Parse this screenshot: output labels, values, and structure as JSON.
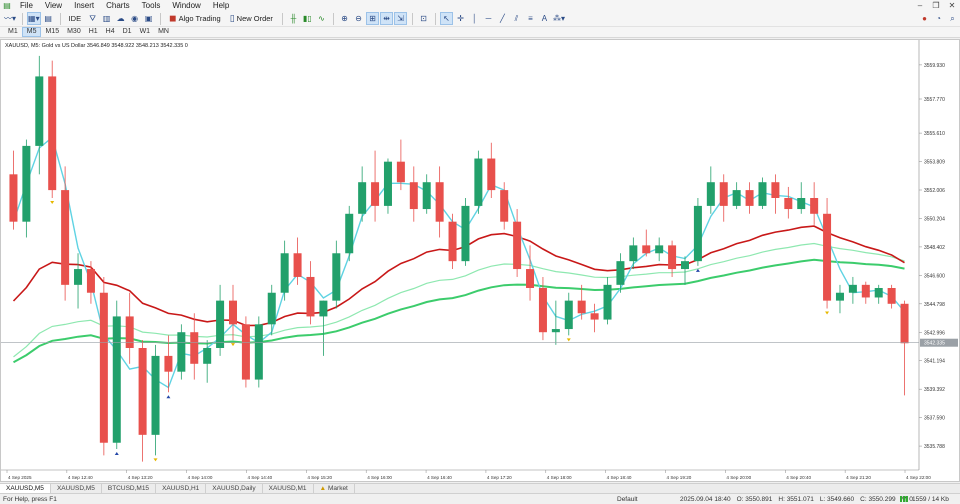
{
  "menu": [
    "File",
    "View",
    "Insert",
    "Charts",
    "Tools",
    "Window",
    "Help"
  ],
  "toolbar": {
    "ide_label": "IDE",
    "algo_label": "Algo Trading",
    "new_order_label": "New Order"
  },
  "timeframes": [
    "M1",
    "M5",
    "M15",
    "M30",
    "H1",
    "H4",
    "D1",
    "W1",
    "MN"
  ],
  "active_timeframe": "M5",
  "chart_header": "XAUUSD, M5:  Gold vs US Dollar  3546.849 3548.922 3548.213 3542.335  0",
  "chart_data": {
    "type": "candlestick",
    "symbol": "XAUUSD",
    "timeframe": "M5",
    "ylim": [
      3534.4,
      3561.0
    ],
    "price_ticks": [
      "3559.930",
      "3557.770",
      "3555.610",
      "3553.809",
      "3552.006",
      "3550.204",
      "3548.402",
      "3546.600",
      "3544.798",
      "3542.996",
      "3541.194",
      "3539.392",
      "3537.590",
      "3535.788"
    ],
    "current_price": "3542.335",
    "time_ticks": [
      "4 Sep 2025",
      "4 Sep 12:40",
      "4 Sep 13:20",
      "4 Sep 14:00",
      "4 Sep 14:40",
      "4 Sep 15:20",
      "4 Sep 16:00",
      "4 Sep 16:40",
      "4 Sep 17:20",
      "4 Sep 18:00",
      "4 Sep 18:40",
      "4 Sep 19:20",
      "4 Sep 20:00",
      "4 Sep 20:40",
      "4 Sep 21:20",
      "4 Sep 22:00"
    ],
    "colors": {
      "bull": "#22a06b",
      "bear": "#e8504c",
      "ma_fast": "#5fd3e3",
      "ma_slow": "#c81818",
      "ma_green1": "#3ccc6c",
      "ma_green2": "#8ee8b0"
    },
    "candles": [
      [
        3553.0,
        3554.5,
        3549.5,
        3550.0
      ],
      [
        3550.0,
        3555.2,
        3549.0,
        3554.8
      ],
      [
        3554.8,
        3560.5,
        3553.0,
        3559.2
      ],
      [
        3559.2,
        3560.2,
        3551.5,
        3552.0
      ],
      [
        3552.0,
        3553.5,
        3545.0,
        3546.0
      ],
      [
        3546.0,
        3548.0,
        3544.5,
        3547.0
      ],
      [
        3547.0,
        3547.5,
        3544.8,
        3545.5
      ],
      [
        3545.5,
        3546.5,
        3535.2,
        3536.0
      ],
      [
        3536.0,
        3545.0,
        3535.6,
        3544.0
      ],
      [
        3544.0,
        3545.5,
        3541.0,
        3542.0
      ],
      [
        3542.0,
        3542.5,
        3534.8,
        3536.5
      ],
      [
        3536.5,
        3542.2,
        3535.2,
        3541.5
      ],
      [
        3541.5,
        3542.8,
        3539.2,
        3540.5
      ],
      [
        3540.5,
        3543.5,
        3540.0,
        3543.0
      ],
      [
        3543.0,
        3544.2,
        3540.0,
        3541.0
      ],
      [
        3541.0,
        3542.5,
        3539.8,
        3542.0
      ],
      [
        3542.0,
        3546.0,
        3541.5,
        3545.0
      ],
      [
        3545.0,
        3546.0,
        3542.5,
        3543.5
      ],
      [
        3543.5,
        3544.0,
        3539.5,
        3540.0
      ],
      [
        3540.0,
        3544.0,
        3539.5,
        3543.5
      ],
      [
        3543.5,
        3546.0,
        3542.8,
        3545.5
      ],
      [
        3545.5,
        3548.8,
        3545.0,
        3548.0
      ],
      [
        3548.0,
        3549.0,
        3546.0,
        3546.5
      ],
      [
        3546.5,
        3547.5,
        3543.5,
        3544.0
      ],
      [
        3544.0,
        3545.0,
        3541.5,
        3545.0
      ],
      [
        3545.0,
        3548.8,
        3544.5,
        3548.0
      ],
      [
        3548.0,
        3551.0,
        3547.5,
        3550.5
      ],
      [
        3550.5,
        3553.5,
        3550.0,
        3552.5
      ],
      [
        3552.5,
        3554.5,
        3550.0,
        3551.0
      ],
      [
        3551.0,
        3554.0,
        3550.5,
        3553.8
      ],
      [
        3553.8,
        3555.2,
        3552.0,
        3552.5
      ],
      [
        3552.5,
        3553.5,
        3550.0,
        3550.8
      ],
      [
        3550.8,
        3553.0,
        3550.5,
        3552.5
      ],
      [
        3552.5,
        3553.5,
        3549.0,
        3550.0
      ],
      [
        3550.0,
        3550.5,
        3547.0,
        3547.5
      ],
      [
        3547.5,
        3551.5,
        3547.2,
        3551.0
      ],
      [
        3551.0,
        3554.5,
        3550.5,
        3554.0
      ],
      [
        3554.0,
        3555.0,
        3551.5,
        3552.0
      ],
      [
        3552.0,
        3552.5,
        3549.5,
        3550.0
      ],
      [
        3550.0,
        3550.8,
        3546.5,
        3547.0
      ],
      [
        3547.0,
        3548.5,
        3545.0,
        3545.8
      ],
      [
        3545.8,
        3546.5,
        3542.5,
        3543.0
      ],
      [
        3543.0,
        3545.0,
        3542.2,
        3543.2
      ],
      [
        3543.2,
        3545.5,
        3542.8,
        3545.0
      ],
      [
        3545.0,
        3546.0,
        3543.8,
        3544.2
      ],
      [
        3544.2,
        3544.8,
        3543.0,
        3543.8
      ],
      [
        3543.8,
        3546.5,
        3543.5,
        3546.0
      ],
      [
        3546.0,
        3548.0,
        3545.5,
        3547.5
      ],
      [
        3547.5,
        3549.0,
        3547.0,
        3548.5
      ],
      [
        3548.5,
        3549.5,
        3547.8,
        3548.0
      ],
      [
        3548.0,
        3549.0,
        3547.5,
        3548.5
      ],
      [
        3548.5,
        3548.8,
        3546.5,
        3547.0
      ],
      [
        3547.0,
        3547.8,
        3546.0,
        3547.5
      ],
      [
        3547.5,
        3551.5,
        3547.2,
        3551.0
      ],
      [
        3551.0,
        3553.5,
        3550.5,
        3552.5
      ],
      [
        3552.5,
        3553.0,
        3550.0,
        3551.0
      ],
      [
        3551.0,
        3552.5,
        3550.8,
        3552.0
      ],
      [
        3552.0,
        3552.5,
        3550.5,
        3551.0
      ],
      [
        3551.0,
        3552.8,
        3550.8,
        3552.5
      ],
      [
        3552.5,
        3553.0,
        3550.5,
        3551.5
      ],
      [
        3551.5,
        3552.2,
        3550.2,
        3550.8
      ],
      [
        3550.8,
        3552.5,
        3550.5,
        3551.5
      ],
      [
        3551.5,
        3552.5,
        3549.8,
        3550.5
      ],
      [
        3550.5,
        3551.5,
        3544.5,
        3545.0
      ],
      [
        3545.0,
        3546.0,
        3544.2,
        3545.5
      ],
      [
        3545.5,
        3546.5,
        3544.8,
        3546.0
      ],
      [
        3546.0,
        3546.2,
        3544.8,
        3545.2
      ],
      [
        3545.2,
        3546.0,
        3544.8,
        3545.8
      ],
      [
        3545.8,
        3546.0,
        3544.5,
        3544.8
      ],
      [
        3544.8,
        3545.0,
        3539.0,
        3542.3
      ]
    ]
  },
  "tabs": [
    "XAUUSD,M5",
    "XAUUSD,M5",
    "BTCUSD,M15",
    "XAUUSD,H1",
    "XAUUSD,Daily",
    "XAUUSD,M1",
    "Market"
  ],
  "status": {
    "help": "For Help, press F1",
    "profile": "Default",
    "datetime": "2025.09.04 18:40",
    "open": "O: 3550.891",
    "high": "H: 3551.071",
    "low": "L: 3549.660",
    "close": "C: 3550.299",
    "volume": "V: 0",
    "traffic": "1559 / 14 Kb"
  }
}
